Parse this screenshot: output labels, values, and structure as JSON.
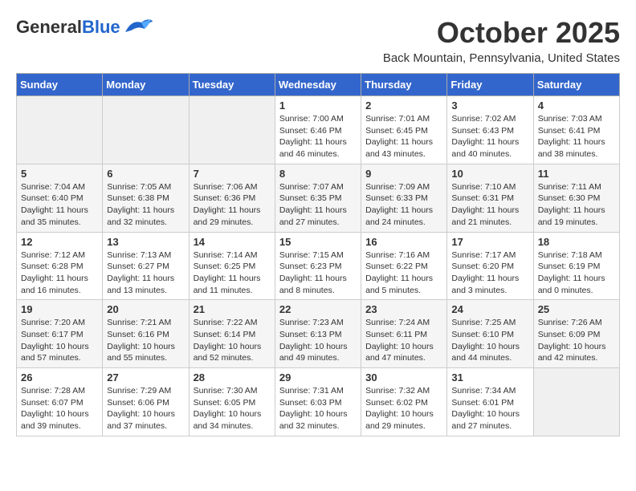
{
  "header": {
    "logo_general": "General",
    "logo_blue": "Blue",
    "month_title": "October 2025",
    "location": "Back Mountain, Pennsylvania, United States"
  },
  "days_of_week": [
    "Sunday",
    "Monday",
    "Tuesday",
    "Wednesday",
    "Thursday",
    "Friday",
    "Saturday"
  ],
  "weeks": [
    [
      {
        "day": "",
        "info": ""
      },
      {
        "day": "",
        "info": ""
      },
      {
        "day": "",
        "info": ""
      },
      {
        "day": "1",
        "info": "Sunrise: 7:00 AM\nSunset: 6:46 PM\nDaylight: 11 hours\nand 46 minutes."
      },
      {
        "day": "2",
        "info": "Sunrise: 7:01 AM\nSunset: 6:45 PM\nDaylight: 11 hours\nand 43 minutes."
      },
      {
        "day": "3",
        "info": "Sunrise: 7:02 AM\nSunset: 6:43 PM\nDaylight: 11 hours\nand 40 minutes."
      },
      {
        "day": "4",
        "info": "Sunrise: 7:03 AM\nSunset: 6:41 PM\nDaylight: 11 hours\nand 38 minutes."
      }
    ],
    [
      {
        "day": "5",
        "info": "Sunrise: 7:04 AM\nSunset: 6:40 PM\nDaylight: 11 hours\nand 35 minutes."
      },
      {
        "day": "6",
        "info": "Sunrise: 7:05 AM\nSunset: 6:38 PM\nDaylight: 11 hours\nand 32 minutes."
      },
      {
        "day": "7",
        "info": "Sunrise: 7:06 AM\nSunset: 6:36 PM\nDaylight: 11 hours\nand 29 minutes."
      },
      {
        "day": "8",
        "info": "Sunrise: 7:07 AM\nSunset: 6:35 PM\nDaylight: 11 hours\nand 27 minutes."
      },
      {
        "day": "9",
        "info": "Sunrise: 7:09 AM\nSunset: 6:33 PM\nDaylight: 11 hours\nand 24 minutes."
      },
      {
        "day": "10",
        "info": "Sunrise: 7:10 AM\nSunset: 6:31 PM\nDaylight: 11 hours\nand 21 minutes."
      },
      {
        "day": "11",
        "info": "Sunrise: 7:11 AM\nSunset: 6:30 PM\nDaylight: 11 hours\nand 19 minutes."
      }
    ],
    [
      {
        "day": "12",
        "info": "Sunrise: 7:12 AM\nSunset: 6:28 PM\nDaylight: 11 hours\nand 16 minutes."
      },
      {
        "day": "13",
        "info": "Sunrise: 7:13 AM\nSunset: 6:27 PM\nDaylight: 11 hours\nand 13 minutes."
      },
      {
        "day": "14",
        "info": "Sunrise: 7:14 AM\nSunset: 6:25 PM\nDaylight: 11 hours\nand 11 minutes."
      },
      {
        "day": "15",
        "info": "Sunrise: 7:15 AM\nSunset: 6:23 PM\nDaylight: 11 hours\nand 8 minutes."
      },
      {
        "day": "16",
        "info": "Sunrise: 7:16 AM\nSunset: 6:22 PM\nDaylight: 11 hours\nand 5 minutes."
      },
      {
        "day": "17",
        "info": "Sunrise: 7:17 AM\nSunset: 6:20 PM\nDaylight: 11 hours\nand 3 minutes."
      },
      {
        "day": "18",
        "info": "Sunrise: 7:18 AM\nSunset: 6:19 PM\nDaylight: 11 hours\nand 0 minutes."
      }
    ],
    [
      {
        "day": "19",
        "info": "Sunrise: 7:20 AM\nSunset: 6:17 PM\nDaylight: 10 hours\nand 57 minutes."
      },
      {
        "day": "20",
        "info": "Sunrise: 7:21 AM\nSunset: 6:16 PM\nDaylight: 10 hours\nand 55 minutes."
      },
      {
        "day": "21",
        "info": "Sunrise: 7:22 AM\nSunset: 6:14 PM\nDaylight: 10 hours\nand 52 minutes."
      },
      {
        "day": "22",
        "info": "Sunrise: 7:23 AM\nSunset: 6:13 PM\nDaylight: 10 hours\nand 49 minutes."
      },
      {
        "day": "23",
        "info": "Sunrise: 7:24 AM\nSunset: 6:11 PM\nDaylight: 10 hours\nand 47 minutes."
      },
      {
        "day": "24",
        "info": "Sunrise: 7:25 AM\nSunset: 6:10 PM\nDaylight: 10 hours\nand 44 minutes."
      },
      {
        "day": "25",
        "info": "Sunrise: 7:26 AM\nSunset: 6:09 PM\nDaylight: 10 hours\nand 42 minutes."
      }
    ],
    [
      {
        "day": "26",
        "info": "Sunrise: 7:28 AM\nSunset: 6:07 PM\nDaylight: 10 hours\nand 39 minutes."
      },
      {
        "day": "27",
        "info": "Sunrise: 7:29 AM\nSunset: 6:06 PM\nDaylight: 10 hours\nand 37 minutes."
      },
      {
        "day": "28",
        "info": "Sunrise: 7:30 AM\nSunset: 6:05 PM\nDaylight: 10 hours\nand 34 minutes."
      },
      {
        "day": "29",
        "info": "Sunrise: 7:31 AM\nSunset: 6:03 PM\nDaylight: 10 hours\nand 32 minutes."
      },
      {
        "day": "30",
        "info": "Sunrise: 7:32 AM\nSunset: 6:02 PM\nDaylight: 10 hours\nand 29 minutes."
      },
      {
        "day": "31",
        "info": "Sunrise: 7:34 AM\nSunset: 6:01 PM\nDaylight: 10 hours\nand 27 minutes."
      },
      {
        "day": "",
        "info": ""
      }
    ]
  ]
}
